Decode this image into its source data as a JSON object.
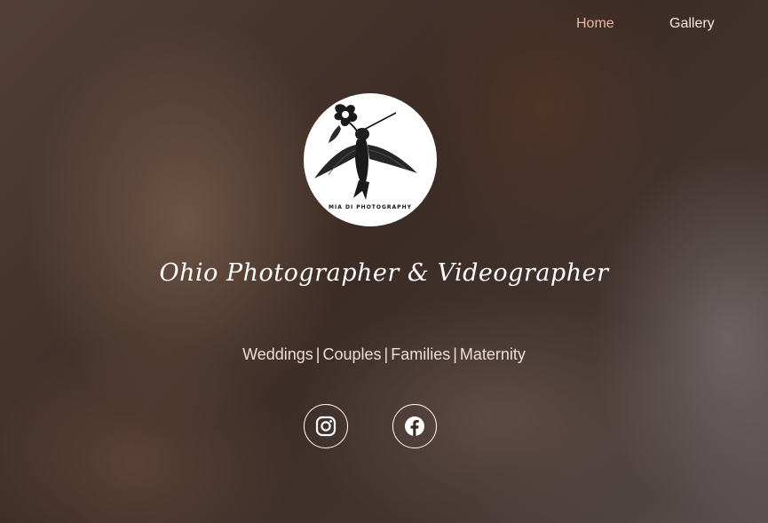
{
  "nav": {
    "items": [
      {
        "label": "Home",
        "active": true
      },
      {
        "label": "Gallery",
        "active": false
      }
    ]
  },
  "logo": {
    "text": "MIA DI PHOTOGRAPHY",
    "icon": "hummingbird-icon"
  },
  "hero": {
    "tagline": "Ohio Photographer & Videographer",
    "services": [
      "Weddings",
      "Couples",
      "Families",
      "Maternity"
    ],
    "separator": "|"
  },
  "social": [
    {
      "name": "instagram",
      "icon": "instagram-icon"
    },
    {
      "name": "facebook",
      "icon": "facebook-icon"
    }
  ],
  "colors": {
    "nav_active": "#e8b9a4",
    "nav_text": "#f1ece8",
    "text": "#ffffff"
  }
}
